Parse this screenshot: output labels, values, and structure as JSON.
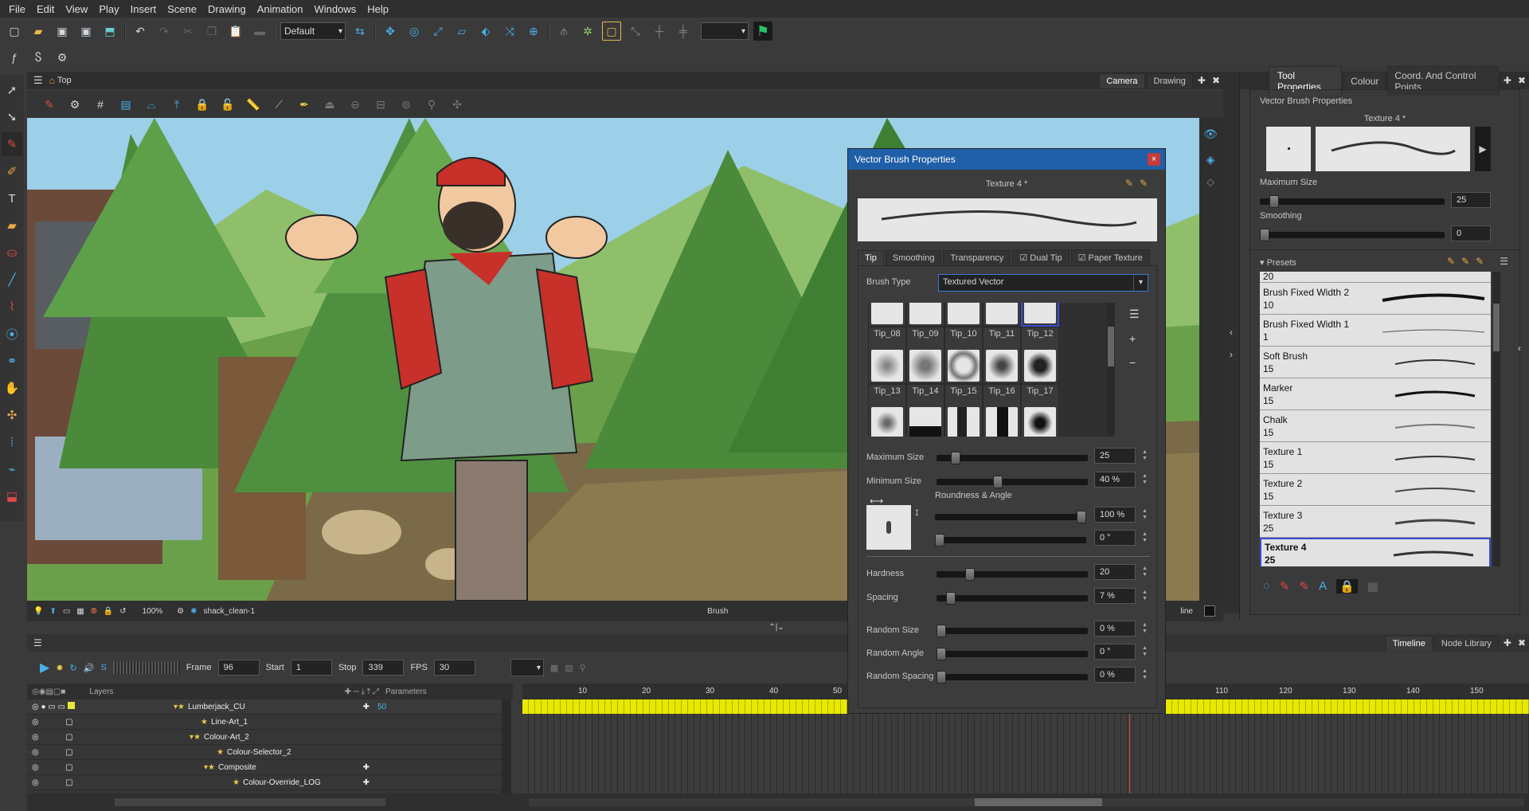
{
  "menu": [
    "File",
    "Edit",
    "View",
    "Play",
    "Insert",
    "Scene",
    "Drawing",
    "Animation",
    "Windows",
    "Help"
  ],
  "toolbar": {
    "workspace": "Default"
  },
  "view": {
    "tab_label": "Top",
    "camera_tab": "Camera",
    "drawing_tab": "Drawing",
    "zoom": "100%",
    "drawing_name": "shack_clean-1",
    "tool_name": "Brush"
  },
  "dialog": {
    "title": "Vector Brush Properties",
    "close": "×",
    "preset_name": "Texture 4 *",
    "tabs": [
      "Tip",
      "Smoothing",
      "Transparency",
      "Dual Tip",
      "Paper Texture"
    ],
    "brush_type_label": "Brush Type",
    "brush_type": "Textured Vector",
    "tips_row1": [
      "Tip_08",
      "Tip_09",
      "Tip_10",
      "Tip_11",
      "Tip_12"
    ],
    "tips_row2": [
      "Tip_13",
      "Tip_14",
      "Tip_15",
      "Tip_16",
      "Tip_17"
    ],
    "max_size_label": "Maximum Size",
    "max_size": "25",
    "max_size_frac": 0.1,
    "min_size_label": "Minimum Size",
    "min_size": "40 %",
    "min_size_frac": 0.4,
    "roundness_label": "Roundness & Angle",
    "roundness": "100 %",
    "roundness_frac": 1.0,
    "angle": "0 °",
    "angle_frac": 0.0,
    "hardness_label": "Hardness",
    "hardness": "20",
    "hardness_frac": 0.2,
    "spacing_label": "Spacing",
    "spacing": "7 %",
    "spacing_frac": 0.07,
    "random_size_label": "Random Size",
    "random_size": "0 %",
    "random_angle_label": "Random Angle",
    "random_angle": "0 °",
    "random_spacing_label": "Random Spacing",
    "random_spacing": "0 %"
  },
  "right": {
    "tabs": [
      "Tool Properties",
      "Colour",
      "Coord. And Control Points"
    ],
    "section": "Vector Brush Properties",
    "preset_name": "Texture 4 *",
    "max_size_label": "Maximum Size",
    "max_size": "25",
    "smoothing_label": "Smoothing",
    "smoothing": "0",
    "presets_label": "Presets",
    "presets": [
      {
        "name": "Brush Fixed Width 2",
        "value": "10"
      },
      {
        "name": "Brush Fixed Width 1",
        "value": "1"
      },
      {
        "name": "Soft Brush",
        "value": "15"
      },
      {
        "name": "Marker",
        "value": "15"
      },
      {
        "name": "Chalk",
        "value": "15"
      },
      {
        "name": "Texture 1",
        "value": "15"
      },
      {
        "name": "Texture 2",
        "value": "15"
      },
      {
        "name": "Texture 3",
        "value": "25"
      },
      {
        "name": "Texture 4",
        "value": "25"
      }
    ],
    "first_partial": "20"
  },
  "timeline": {
    "frame_label": "Frame",
    "frame": "96",
    "start_label": "Start",
    "start": "1",
    "stop_label": "Stop",
    "stop": "339",
    "fps_label": "FPS",
    "fps": "30",
    "layers_label": "Layers",
    "parameters_label": "Parameters",
    "layers": [
      "Lumberjack_CU",
      "Line-Art_1",
      "Colour-Art_2",
      "Colour-Selector_2",
      "Composite",
      "Colour-Override_LOG"
    ],
    "first_value": "50",
    "ticks": [
      "10",
      "20",
      "30",
      "40",
      "50",
      "110",
      "120",
      "130",
      "140",
      "150"
    ],
    "tabs": [
      "Timeline",
      "Node Library"
    ],
    "line_label": "line"
  }
}
